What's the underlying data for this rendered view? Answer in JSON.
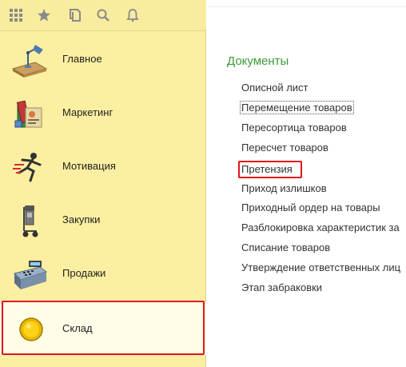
{
  "toolbar": {
    "icons": [
      "apps-grid-icon",
      "favorites-star-icon",
      "history-icon",
      "search-icon",
      "notifications-bell-icon"
    ]
  },
  "sidebar": {
    "items": [
      {
        "label": "Главное",
        "icon": "desk-lamp-icon"
      },
      {
        "label": "Маркетинг",
        "icon": "marketing-books-icon"
      },
      {
        "label": "Мотивация",
        "icon": "runner-icon"
      },
      {
        "label": "Закупки",
        "icon": "hand-truck-icon"
      },
      {
        "label": "Продажи",
        "icon": "cash-register-icon"
      },
      {
        "label": "Склад",
        "icon": "gold-coin-icon",
        "selected": true
      }
    ]
  },
  "content": {
    "section_title": "Документы",
    "documents": [
      "Описной лист",
      "Перемещение товаров",
      "Пересортица товаров",
      "Пересчет товаров",
      "Претензия",
      "Приход излишков",
      "Приходный ордер на товары",
      "Разблокировка характеристик за",
      "Списание товаров",
      "Утверждение ответственных лиц",
      "Этап забраковки"
    ]
  },
  "colors": {
    "sidebar_bg": "#fcefa1",
    "selected_bg": "#fffde8",
    "highlight_red": "#e0161c",
    "section_green": "#3a9a3a"
  }
}
